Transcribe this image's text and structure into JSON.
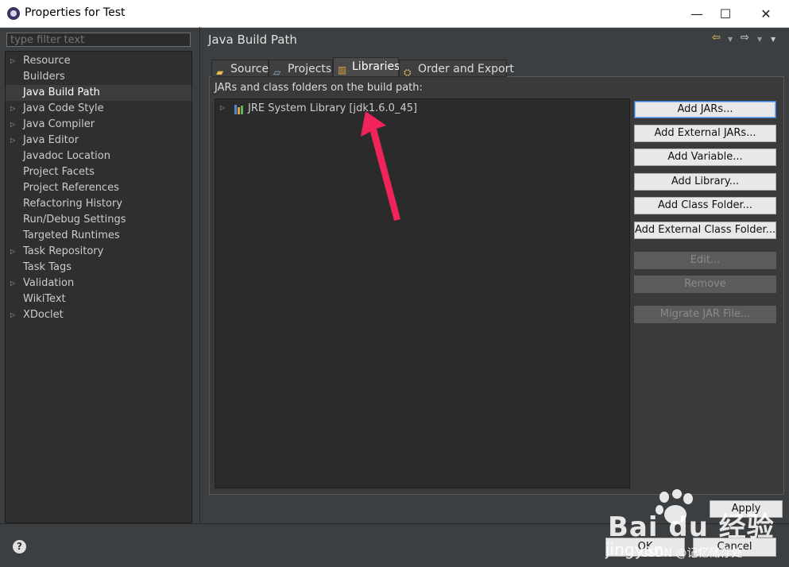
{
  "window": {
    "title": "Properties for Test",
    "minimize_icon": "minimize-icon",
    "maximize_icon": "maximize-icon",
    "close_icon": "close-icon",
    "minimize": "—",
    "maximize": "☐",
    "close": "✕"
  },
  "filter": {
    "placeholder": "type filter text",
    "value": ""
  },
  "sidebar": {
    "items": [
      {
        "label": "Resource",
        "expandable": true
      },
      {
        "label": "Builders",
        "expandable": false
      },
      {
        "label": "Java Build Path",
        "expandable": false,
        "selected": true
      },
      {
        "label": "Java Code Style",
        "expandable": true
      },
      {
        "label": "Java Compiler",
        "expandable": true
      },
      {
        "label": "Java Editor",
        "expandable": true
      },
      {
        "label": "Javadoc Location",
        "expandable": false
      },
      {
        "label": "Project Facets",
        "expandable": false
      },
      {
        "label": "Project References",
        "expandable": false
      },
      {
        "label": "Refactoring History",
        "expandable": false
      },
      {
        "label": "Run/Debug Settings",
        "expandable": false
      },
      {
        "label": "Targeted Runtimes",
        "expandable": false
      },
      {
        "label": "Task Repository",
        "expandable": true
      },
      {
        "label": "Task Tags",
        "expandable": false
      },
      {
        "label": "Validation",
        "expandable": true
      },
      {
        "label": "WikiText",
        "expandable": false
      },
      {
        "label": "XDoclet",
        "expandable": true
      }
    ]
  },
  "page": {
    "title": "Java Build Path",
    "back_glyph": "⇦",
    "forward_glyph": "⇨",
    "tabs": [
      {
        "label": "Source",
        "icon": "source-folder-icon"
      },
      {
        "label": "Projects",
        "icon": "projects-icon"
      },
      {
        "label": "Libraries",
        "icon": "libraries-icon",
        "active": true
      },
      {
        "label": "Order and Export",
        "icon": "order-export-icon"
      }
    ],
    "panel_label": "JARs and class folders on the build path:",
    "tree": [
      {
        "label": "JRE System Library [jdk1.6.0_45]",
        "icon": "library-icon"
      }
    ],
    "buttons": [
      {
        "label": "Add JARs...",
        "enabled": true,
        "primary": true
      },
      {
        "label": "Add External JARs...",
        "enabled": true
      },
      {
        "label": "Add Variable...",
        "enabled": true
      },
      {
        "label": "Add Library...",
        "enabled": true
      },
      {
        "label": "Add Class Folder...",
        "enabled": true
      },
      {
        "label": "Add External Class Folder...",
        "enabled": true
      },
      {
        "label": "Edit...",
        "enabled": false
      },
      {
        "label": "Remove",
        "enabled": false
      },
      {
        "label": "Migrate JAR File...",
        "enabled": false
      }
    ],
    "apply_label": "Apply"
  },
  "footer": {
    "help_glyph": "?",
    "ok_label": "OK",
    "cancel_label": "Cancel"
  },
  "annotation": {
    "arrow_color": "#f0245a"
  },
  "watermark": {
    "baidu": "Bai du 经验",
    "jingyan": "jingyan",
    "csdn": "CSDN @记忆储存处"
  },
  "colors": {
    "dialog_bg": "#3c3f41",
    "tree_bg": "#2b2b2b",
    "button_bg": "#e8e8e8",
    "disabled_button_bg": "#5b5b5b",
    "focus_border": "#3a7bd5"
  }
}
